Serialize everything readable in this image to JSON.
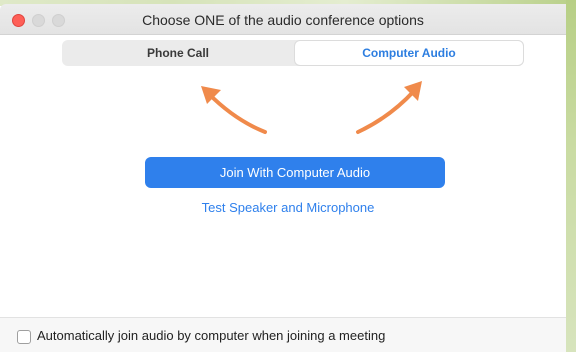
{
  "window": {
    "title": "Choose ONE of the audio conference options"
  },
  "tabs": [
    {
      "label": "Phone Call",
      "selected": false
    },
    {
      "label": "Computer Audio",
      "selected": true
    }
  ],
  "main": {
    "join_button_label": "Join With Computer Audio",
    "test_link_label": "Test Speaker and Microphone"
  },
  "footer": {
    "checkbox_label": "Automatically join audio by computer when joining a meeting",
    "checkbox_checked": false
  },
  "colors": {
    "accent": "#2f80ec",
    "arrow": "#f08a4b",
    "close": "#fe5f57"
  },
  "icons": [
    "close-icon",
    "minimize-icon",
    "maximize-icon",
    "arrow-to-phone-call-icon",
    "arrow-to-computer-audio-icon"
  ]
}
